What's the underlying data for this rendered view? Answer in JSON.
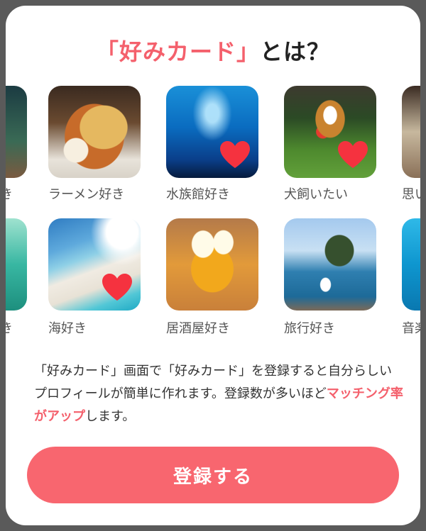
{
  "title": {
    "accent": "「好みカード」",
    "rest": "とは？"
  },
  "cards_row1": [
    {
      "label": "ラーメン好き",
      "icon": "ramen-photo",
      "liked": false
    },
    {
      "label": "水族館好き",
      "icon": "aquarium-photo",
      "liked": true
    },
    {
      "label": "犬飼いたい",
      "icon": "dog-photo",
      "liked": true
    }
  ],
  "cards_row2": [
    {
      "label": "海好き",
      "icon": "beach-photo",
      "liked": true
    },
    {
      "label": "居酒屋好き",
      "icon": "beer-photo",
      "liked": false
    },
    {
      "label": "旅行好き",
      "icon": "travel-photo",
      "liked": false
    }
  ],
  "partial_labels": {
    "left_row1": "き",
    "right_row1": "思い",
    "left_row2": "き",
    "right_row2": "音楽"
  },
  "description": {
    "part1": "「好みカード」画面で「好みカード」を登録すると自分らしいプロフィールが簡単に作れます。登録数が多いほど",
    "highlight": "マッチング率がアップ",
    "part2": "します。"
  },
  "button": {
    "label": "登録する"
  },
  "colors": {
    "accent": "#f4606c",
    "button": "#f8666f",
    "heart": "#f5323f"
  }
}
